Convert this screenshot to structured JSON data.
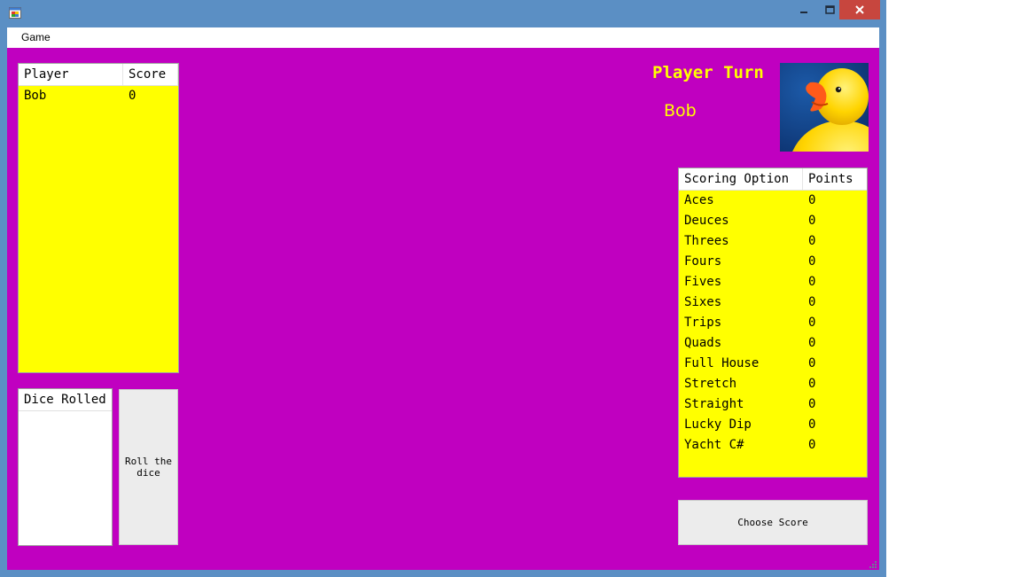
{
  "menu": {
    "game": "Game"
  },
  "players_list": {
    "columns": [
      "Player",
      "Score"
    ],
    "rows": [
      {
        "player": "Bob",
        "score": "0"
      }
    ]
  },
  "turn": {
    "label": "Player Turn",
    "name": "Bob"
  },
  "scoring_list": {
    "columns": [
      "Scoring Option",
      "Points"
    ],
    "rows": [
      {
        "option": "Aces",
        "points": "0"
      },
      {
        "option": "Deuces",
        "points": "0"
      },
      {
        "option": "Threes",
        "points": "0"
      },
      {
        "option": "Fours",
        "points": "0"
      },
      {
        "option": "Fives",
        "points": "0"
      },
      {
        "option": "Sixes",
        "points": "0"
      },
      {
        "option": "Trips",
        "points": "0"
      },
      {
        "option": "Quads",
        "points": "0"
      },
      {
        "option": "Full House",
        "points": "0"
      },
      {
        "option": "Stretch",
        "points": "0"
      },
      {
        "option": "Straight",
        "points": "0"
      },
      {
        "option": "Lucky Dip",
        "points": "0"
      },
      {
        "option": "Yacht C#",
        "points": "0"
      }
    ]
  },
  "dice_list": {
    "header": "Dice Rolled"
  },
  "buttons": {
    "roll": "Roll the dice",
    "choose": "Choose Score"
  },
  "colors": {
    "background": "#c000c0",
    "list_fill": "#ffff00",
    "accent_text": "#ffff00",
    "close_button": "#c7463e"
  },
  "icons": {
    "app": "app-icon",
    "duck": "rubber-duck-image"
  }
}
